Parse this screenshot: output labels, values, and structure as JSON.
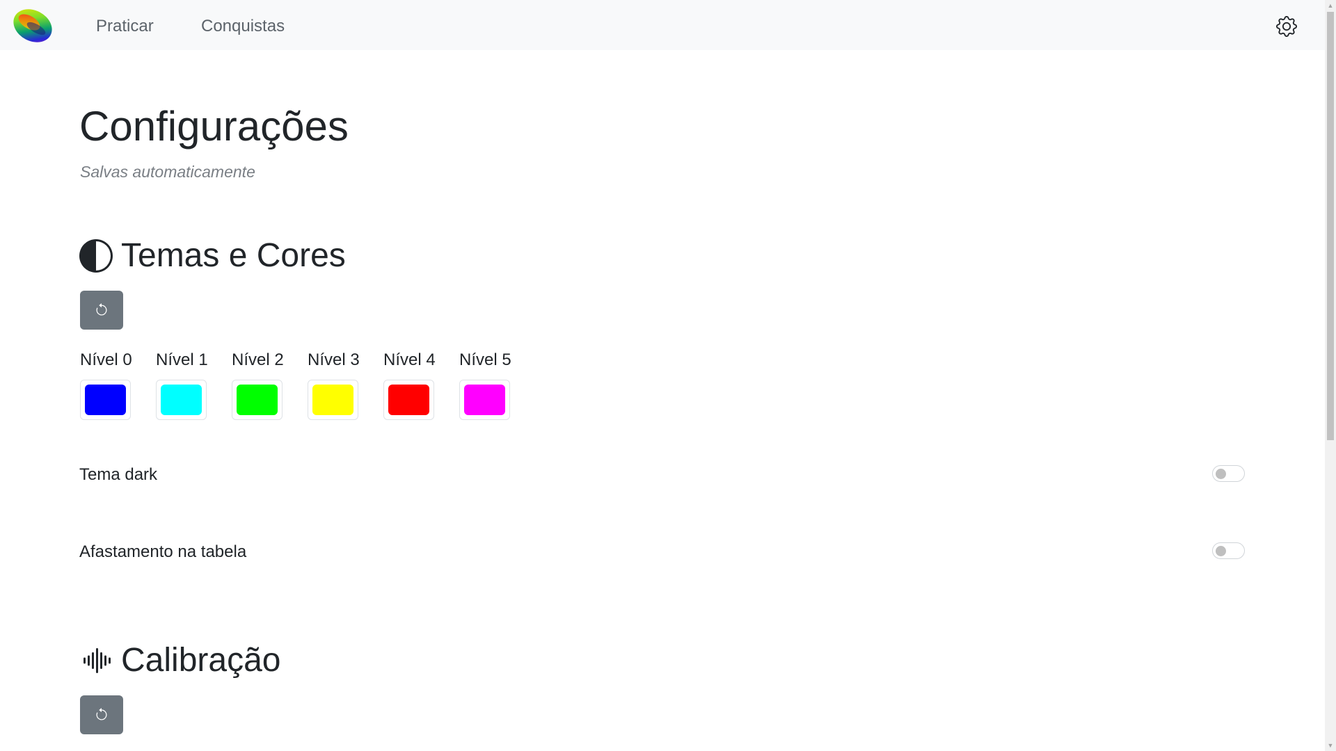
{
  "navbar": {
    "links": [
      {
        "label": "Praticar"
      },
      {
        "label": "Conquistas"
      }
    ]
  },
  "page": {
    "title": "Configurações",
    "subtitle": "Salvas automaticamente"
  },
  "sections": {
    "temas": {
      "title": "Temas e Cores",
      "icon": "contrast-icon",
      "levels": [
        {
          "label": "Nível 0",
          "color": "#0000ff"
        },
        {
          "label": "Nível 1",
          "color": "#00ffff"
        },
        {
          "label": "Nível 2",
          "color": "#00ff00"
        },
        {
          "label": "Nível 3",
          "color": "#ffff00"
        },
        {
          "label": "Nível 4",
          "color": "#ff0000"
        },
        {
          "label": "Nível 5",
          "color": "#ff00ff"
        }
      ],
      "options": [
        {
          "label": "Tema dark",
          "enabled": false
        },
        {
          "label": "Afastamento na tabela",
          "enabled": false
        }
      ]
    },
    "calibracao": {
      "title": "Calibração",
      "icon": "soundwave-icon"
    }
  },
  "icons": {
    "reset": "arrow-counterclockwise-icon",
    "settings": "gear-icon",
    "logo": "app-logo"
  }
}
